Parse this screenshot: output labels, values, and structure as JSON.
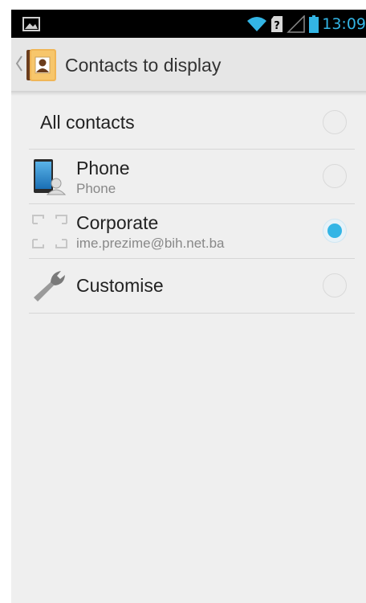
{
  "status_bar": {
    "time": "13:09",
    "icons": [
      "image-notification-icon",
      "wifi-icon",
      "no-sim-icon",
      "signal-icon",
      "battery-icon"
    ]
  },
  "action_bar": {
    "title": "Contacts to display",
    "app_icon": "contacts-app-icon",
    "back_icon": "up-caret-icon"
  },
  "list": {
    "items": [
      {
        "title": "All contacts",
        "subtitle": "",
        "icon": null,
        "selected": false
      },
      {
        "title": "Phone",
        "subtitle": "Phone",
        "icon": "phone-account-icon",
        "selected": false
      },
      {
        "title": "Corporate",
        "subtitle": "ime.prezime@bih.net.ba",
        "icon": "corporate-account-icon",
        "selected": true
      },
      {
        "title": "Customise",
        "subtitle": "",
        "icon": "wrench-icon",
        "selected": false
      }
    ]
  },
  "colors": {
    "accent": "#33b5e5",
    "background": "#efefef",
    "action_bar": "#e6e6e6",
    "status_bar": "#000000"
  }
}
